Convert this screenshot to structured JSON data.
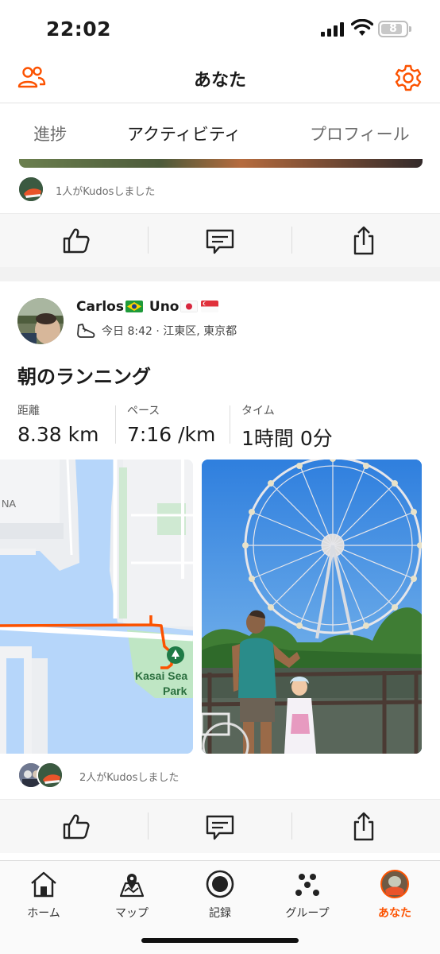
{
  "status_bar": {
    "time": "22:02",
    "battery": "8"
  },
  "header": {
    "title": "あなた"
  },
  "tabs": [
    {
      "label": "進捗"
    },
    {
      "label": "アクティビティ",
      "active": true
    },
    {
      "label": "プロフィール"
    }
  ],
  "previous_card": {
    "kudos_text": "1人がKudosしました"
  },
  "activity": {
    "author": {
      "name_part1": "Carlos",
      "name_part2": "Uno",
      "flags": [
        "brazil",
        "japan",
        "singapore"
      ]
    },
    "meta": "今日 8:42 · 江東区, 東京都",
    "title": "朝のランニング",
    "stats": [
      {
        "label": "距離",
        "value": "8.38 km"
      },
      {
        "label": "ペース",
        "value": "7:16 /km"
      },
      {
        "label": "タイム",
        "value": "1時間 0分"
      }
    ],
    "map_labels": {
      "na": "NA",
      "park_line1": "Kasai Sea",
      "park_line2": "Park"
    },
    "kudos_text": "2人がKudosしました"
  },
  "bottom_nav": [
    {
      "label": "ホーム",
      "icon": "home-icon"
    },
    {
      "label": "マップ",
      "icon": "map-icon"
    },
    {
      "label": "記録",
      "icon": "record-icon"
    },
    {
      "label": "グループ",
      "icon": "groups-icon"
    },
    {
      "label": "あなた",
      "icon": "you-avatar",
      "active": true
    }
  ],
  "colors": {
    "accent": "#fc5200",
    "route": "#fc5200",
    "water": "#b6d6fa",
    "park": "#bfe6c4"
  }
}
